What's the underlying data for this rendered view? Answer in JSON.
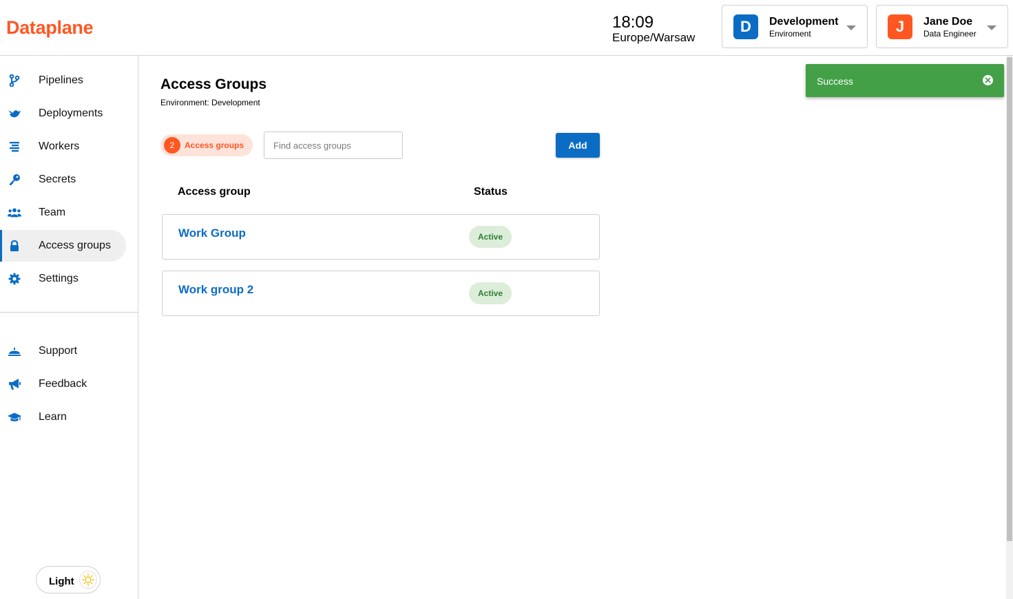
{
  "app": {
    "logo": "Dataplane"
  },
  "header": {
    "time": "18:09",
    "timezone": "Europe/Warsaw",
    "environment": {
      "badge": "D",
      "title": "Development",
      "subtitle": "Enviroment"
    },
    "user": {
      "badge": "J",
      "name": "Jane Doe",
      "role": "Data Engineer"
    }
  },
  "sidebar": {
    "items": [
      {
        "label": "Pipelines",
        "icon": "pipelines-icon"
      },
      {
        "label": "Deployments",
        "icon": "deployments-icon"
      },
      {
        "label": "Workers",
        "icon": "workers-icon"
      },
      {
        "label": "Secrets",
        "icon": "key-icon"
      },
      {
        "label": "Team",
        "icon": "team-icon"
      },
      {
        "label": "Access groups",
        "icon": "lock-icon",
        "active": true
      },
      {
        "label": "Settings",
        "icon": "gear-icon"
      }
    ],
    "bottom_items": [
      {
        "label": "Support",
        "icon": "bell-icon"
      },
      {
        "label": "Feedback",
        "icon": "megaphone-icon"
      },
      {
        "label": "Learn",
        "icon": "graduation-cap-icon"
      }
    ],
    "theme_label": "Light"
  },
  "main": {
    "title": "Access Groups",
    "subtitle": "Environment: Development",
    "count": "2",
    "count_label": "Access groups",
    "search_placeholder": "Find access groups",
    "add_label": "Add",
    "columns": [
      "Access group",
      "Status"
    ],
    "rows": [
      {
        "name": "Work Group",
        "status": "Active"
      },
      {
        "name": "Work group 2",
        "status": "Active"
      }
    ]
  },
  "toast": {
    "message": "Success"
  },
  "colors": {
    "brand": "#ff5722",
    "primary": "#0b6cc4",
    "success": "#43a047",
    "active_badge_bg": "#dcedd9",
    "active_badge_text": "#2e7d32"
  }
}
